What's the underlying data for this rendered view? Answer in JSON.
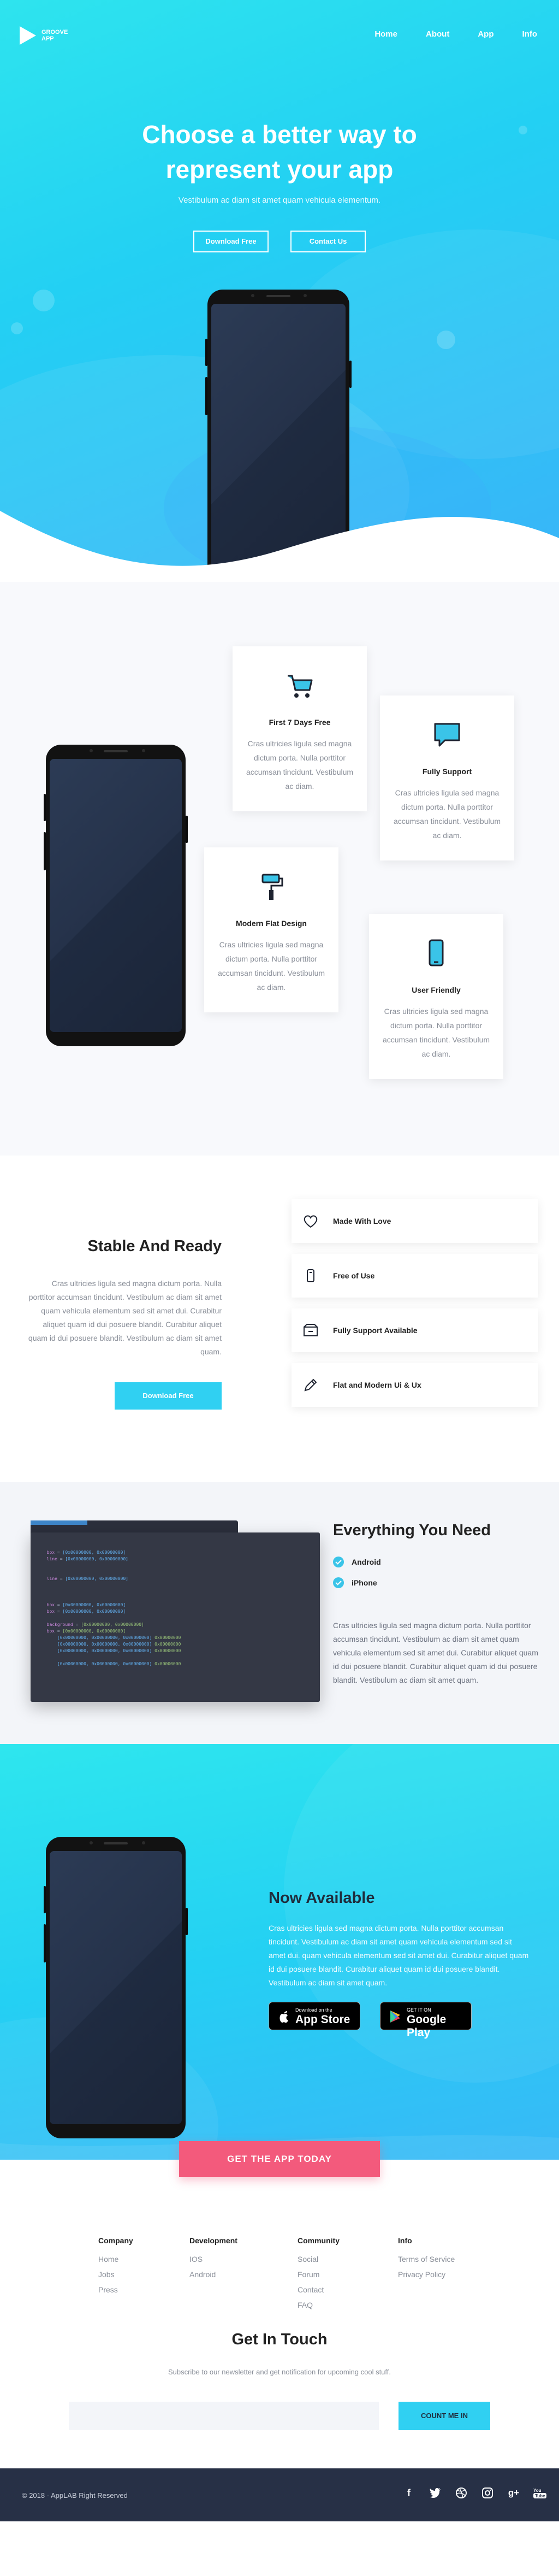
{
  "brand": {
    "logo_line1": "GROOVE",
    "logo_line2": "APP"
  },
  "nav": {
    "items": [
      "Home",
      "About",
      "App",
      "Info"
    ]
  },
  "hero": {
    "title_line1": "Choose a better way to",
    "title_line2": "represent your app",
    "subtitle": "Vestibulum ac diam sit amet quam vehicula elementum.",
    "btn_download": "Download Free",
    "btn_contact": "Contact Us"
  },
  "features": {
    "cards": [
      {
        "icon": "cart-icon",
        "title": "First 7 Days Free",
        "text": "Cras ultricies ligula sed magna dictum porta. Nulla porttitor accumsan tincidunt. Vestibulum ac diam."
      },
      {
        "icon": "chat-icon",
        "title": "Fully Support",
        "text": "Cras ultricies ligula sed magna dictum porta. Nulla porttitor accumsan tincidunt. Vestibulum ac diam."
      },
      {
        "icon": "paint-roller-icon",
        "title": "Modern Flat Design",
        "text": "Cras ultricies ligula sed magna dictum porta. Nulla porttitor accumsan tincidunt. Vestibulum ac diam."
      },
      {
        "icon": "smartphone-icon",
        "title": "User Friendly",
        "text": "Cras ultricies ligula sed magna dictum porta. Nulla porttitor accumsan tincidunt. Vestibulum ac diam."
      }
    ]
  },
  "stable": {
    "title": "Stable And Ready",
    "text": "Cras ultricies ligula sed magna dictum porta. Nulla porttitor accumsan tincidunt. Vestibulum ac diam sit amet quam vehicula elementum sed sit amet dui. Curabitur aliquet quam id dui posuere blandit. Curabitur aliquet quam id dui posuere blandit. Vestibulum ac diam sit amet quam.",
    "button": "Download Free",
    "items": [
      {
        "icon": "heart-icon",
        "label": "Made With Love"
      },
      {
        "icon": "hand-tap-icon",
        "label": "Free of Use"
      },
      {
        "icon": "support-box-icon",
        "label": "Fully Support Available"
      },
      {
        "icon": "pencil-icon",
        "label": "Flat and Modern Ui & Ux"
      }
    ]
  },
  "everything": {
    "title": "Everything You Need",
    "checks": [
      "Android",
      "iPhone"
    ],
    "text": "Cras ultricies ligula sed magna dictum porta. Nulla porttitor accumsan tincidunt. Vestibulum ac diam sit amet quam vehicula elementum sed sit amet dui. Curabitur aliquet quam id dui posuere blandit. Curabitur aliquet quam id dui posuere blandit. Vestibulum ac diam sit amet quam."
  },
  "available": {
    "title": "Now Available",
    "text": "Cras ultricies ligula sed magna dictum porta. Nulla porttitor accumsan tincidunt. Vestibulum ac diam sit amet quam vehicula elementum sed sit amet dui. quam vehicula elementum sed sit amet dui. Curabitur aliquet quam id dui posuere blandit. Curabitur aliquet quam id dui posuere blandit. Vestibulum ac diam sit amet quam.",
    "appstore_small": "Download on the",
    "appstore_large": "App Store",
    "googleplay_small": "GET IT ON",
    "googleplay_large": "Google Play",
    "cta": "GET THE APP TODAY"
  },
  "footer_cols": [
    {
      "title": "Company",
      "links": [
        "Home",
        "Jobs",
        "Press"
      ]
    },
    {
      "title": "Development",
      "links": [
        "IOS",
        "Android"
      ]
    },
    {
      "title": "Community",
      "links": [
        "Social",
        "Forum",
        "Contact",
        "FAQ"
      ]
    },
    {
      "title": "Info",
      "links": [
        "Terms of Service",
        "Privacy Policy"
      ]
    }
  ],
  "touch": {
    "title": "Get In Touch",
    "subtitle": "Subscribe to our newsletter and get notification for upcoming cool stuff.",
    "input_value": "",
    "button": "COUNT ME IN"
  },
  "bottom": {
    "copyright": "© 2018 - AppLAB Right Reserved",
    "social": [
      "facebook-icon",
      "twitter-icon",
      "dribbble-icon",
      "instagram-icon",
      "google-plus-icon",
      "youtube-icon"
    ]
  },
  "colors": {
    "cyan": "#2ee4ee",
    "blue": "#3ab4f8",
    "pink": "#f35a7c",
    "navy": "#273046",
    "button_blue": "#30d0f2"
  }
}
